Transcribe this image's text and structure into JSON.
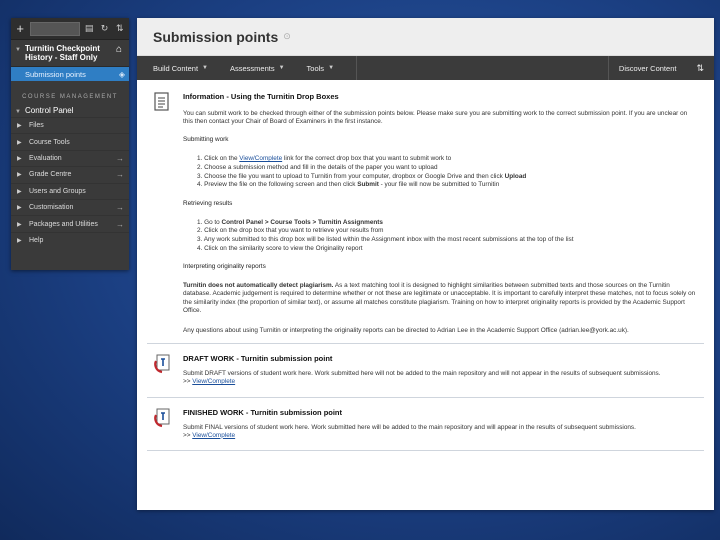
{
  "sidebar": {
    "course_title": "Turnitin Checkpoint History - Staff Only",
    "active_item": "Submission points",
    "section_label": "COURSE MANAGEMENT",
    "control_panel": "Control Panel",
    "items": [
      {
        "label": "Files",
        "has_go": false
      },
      {
        "label": "Course Tools",
        "has_go": false
      },
      {
        "label": "Evaluation",
        "has_go": true
      },
      {
        "label": "Grade Centre",
        "has_go": true
      },
      {
        "label": "Users and Groups",
        "has_go": false
      },
      {
        "label": "Customisation",
        "has_go": true
      },
      {
        "label": "Packages and Utilities",
        "has_go": true
      },
      {
        "label": "Help",
        "has_go": false
      }
    ],
    "icons": [
      "plus-icon",
      "search-field",
      "notepad-icon",
      "refresh-icon",
      "sort-icon",
      "home-icon"
    ]
  },
  "header": {
    "title": "Submission points"
  },
  "toolbar": {
    "build_content": "Build Content",
    "assessments": "Assessments",
    "tools": "Tools",
    "discover_content": "Discover Content"
  },
  "info_item": {
    "title": "Information - Using the Turnitin Drop Boxes",
    "intro": "You can submit work to be checked through either of the submission points below. Please make sure you are submitting work to the correct submission point. If you are unclear on this then contact your Chair of Board of Examiners in the first instance.",
    "submitting_heading": "Submitting work",
    "submitting_steps": {
      "s1_pre": "1. Click on the ",
      "s1_link": "View/Complete",
      "s1_post": " link for the correct drop box that you want to submit work to",
      "s2": "2. Choose a submission method and fill in the details of the paper you want to upload",
      "s3_pre": "3. Choose the file you want to upload to Turnitin from your computer, dropbox or Google Drive and then click ",
      "s3_bold": "Upload",
      "s4_pre": "4. Preview the file on the following screen and then click ",
      "s4_bold": "Submit",
      "s4_post": " - your file will now be submitted to Turnitin"
    },
    "retrieving_heading": "Retrieving results",
    "retrieving_steps": {
      "r1_pre": "1. Go to ",
      "r1_bold": "Control Panel > Course Tools > Turnitin Assignments",
      "r2": "2. Click on the drop box that you want to retrieve your results from",
      "r3": "3. Any work submitted to this drop box will be listed within the Assignment inbox with the most recent submissions at the top of the list",
      "r4": "4. Click on the similarity score to view the Originality report"
    },
    "interpreting_heading": "Interpreting originality reports",
    "interpreting_bold": "Turnitin does not automatically detect plagiarism.",
    "interpreting_text": " As a text matching tool it is designed to highlight similarities between submitted texts and those sources on the Turnitin database. Academic judgement is required to determine whether or not these are legitimate or unacceptable. It is important to carefully interpret these matches, not to focus solely on the similarity index (the proportion of similar text), or assume all matches constitute plagiarism. Training on how to interpret originality reports is provided by the Academic Support Office.",
    "questions_text": "Any questions about using Turnitin or interpreting the originality reports can be directed to Adrian Lee in the Academic Support Office (adrian.lee@york.ac.uk)."
  },
  "draft_item": {
    "title": "DRAFT WORK - Turnitin submission point",
    "desc": "Submit DRAFT versions of student work here. Work submitted here will not be added to the main repository and will not appear in the results of subsequent submissions.",
    "link_prefix": ">> ",
    "link": "View/Complete"
  },
  "final_item": {
    "title": "FINISHED WORK - Turnitin submission point",
    "desc": "Submit FINAL versions of student work here. Work submitted here will be added to the main repository and will appear in the results of subsequent submissions.",
    "link_prefix": ">> ",
    "link": "View/Complete"
  },
  "colors": {
    "background": "#1b3f82",
    "sidebar": "#3a3a3a",
    "active": "#2f7ec4",
    "toolbar": "#3b3b3b",
    "link": "#1a4e9a"
  }
}
